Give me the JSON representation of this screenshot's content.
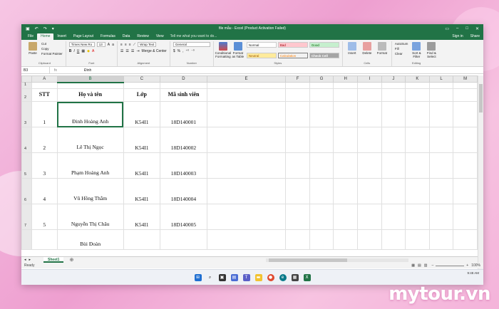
{
  "window": {
    "title": "file mẫu - Excel (Product Activation Failed)",
    "signin": "Sign in",
    "share": "Share"
  },
  "tabs": [
    "File",
    "Home",
    "Insert",
    "Page Layout",
    "Formulas",
    "Data",
    "Review",
    "View"
  ],
  "tell_me": "Tell me what you want to do...",
  "ribbon": {
    "clipboard": {
      "label": "Clipboard",
      "paste": "Paste",
      "cut": "Cut",
      "copy": "Copy",
      "format_painter": "Format Painter"
    },
    "font": {
      "label": "Font",
      "name": "Times New Ro",
      "size": "13",
      "bold": "B",
      "italic": "I",
      "underline": "U"
    },
    "alignment": {
      "label": "Alignment",
      "wrap": "Wrap Text",
      "merge": "Merge & Center"
    },
    "number": {
      "label": "Number",
      "format": "General",
      "pct": "%"
    },
    "styles": {
      "label": "Styles",
      "conditional": "Conditional Formatting",
      "format_as_table": "Format as Table",
      "normal": "Normal",
      "bad": "Bad",
      "good": "Good",
      "neutral": "Neutral",
      "calculation": "Calculation",
      "check_cell": "Check Cell"
    },
    "cells": {
      "label": "Cells",
      "insert": "Insert",
      "delete": "Delete",
      "format": "Format"
    },
    "editing": {
      "label": "Editing",
      "autosum": "AutoSum",
      "fill": "Fill",
      "clear": "Clear",
      "sort": "Sort & Filter",
      "find": "Find & Select"
    }
  },
  "formula_bar": {
    "name_box": "B3",
    "fx": "fx",
    "content": "Đinh"
  },
  "columns": [
    "A",
    "B",
    "C",
    "D",
    "E",
    "F",
    "G",
    "H",
    "I",
    "J",
    "K",
    "L",
    "M"
  ],
  "rows": [
    {
      "num": "1",
      "cells": [
        "",
        "",
        "",
        ""
      ]
    },
    {
      "num": "2",
      "cells": [
        "STT",
        "Họ và tên",
        "Lớp",
        "Mã sinh viên"
      ]
    },
    {
      "num": "3",
      "cells": [
        "1",
        "Đinh Hoàng Anh",
        "K54I1",
        "18D140001"
      ]
    },
    {
      "num": "4",
      "cells": [
        "2",
        "Lê Thị Ngọc",
        "K54I1",
        "18D140002"
      ]
    },
    {
      "num": "5",
      "cells": [
        "3",
        "Phạm Hoàng Anh",
        "K54I1",
        "18D140003"
      ]
    },
    {
      "num": "6",
      "cells": [
        "4",
        "Vũ Hồng Thắm",
        "K54I1",
        "18D140004"
      ]
    },
    {
      "num": "7",
      "cells": [
        "5",
        "Nguyễn Thị Châu",
        "K54I1",
        "18D140005"
      ]
    },
    {
      "num": "",
      "cells": [
        "",
        "Bùi Đoàn",
        "",
        ""
      ]
    }
  ],
  "sheet_tab": "Sheet1",
  "status": {
    "ready": "Ready",
    "zoom": "100%"
  },
  "taskbar": {
    "time": "9:48 AM"
  },
  "brand": "mytour.vn",
  "colors": {
    "excel_green": "#217346",
    "bad_bg": "#ffc7ce",
    "good_bg": "#c6efce",
    "neutral_bg": "#ffeb9c",
    "check_bg": "#a5a5a5"
  }
}
